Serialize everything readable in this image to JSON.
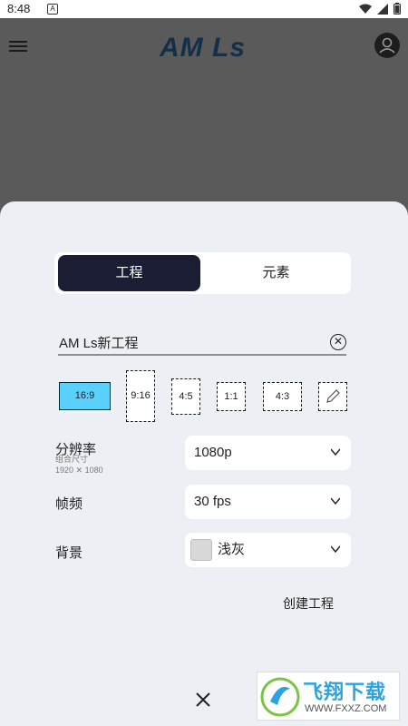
{
  "status_bar": {
    "time": "8:48",
    "notification_badge": "A"
  },
  "app": {
    "logo_text": "AM Ls"
  },
  "sheet": {
    "tabs": [
      {
        "label": "工程",
        "active": true
      },
      {
        "label": "元素",
        "active": false
      }
    ],
    "project_name": {
      "value": "AM Ls新工程"
    },
    "aspect_ratios": [
      {
        "label": "16:9",
        "selected": true
      },
      {
        "label": "9:16",
        "selected": false
      },
      {
        "label": "4:5",
        "selected": false
      },
      {
        "label": "1:1",
        "selected": false
      },
      {
        "label": "4:3",
        "selected": false
      },
      {
        "icon": "pencil-icon",
        "selected": false
      }
    ],
    "resolution": {
      "label": "分辨率",
      "sub_label": "组合尺寸",
      "size": "1920 ✕ 1080",
      "value": "1080p"
    },
    "frame_rate": {
      "label": "帧频",
      "value": "30 fps"
    },
    "background": {
      "label": "背景",
      "value": "浅灰",
      "color": "#d8d8d8"
    },
    "create_label": "创建工程"
  },
  "watermark": {
    "text": "飞翔下载",
    "url": "WWW.FXXZ.COM"
  },
  "colors": {
    "accent": "#5ad0ff",
    "tab_active": "#1a1d33",
    "sheet_bg": "#eceff3",
    "overlay": "#5a5a5a"
  }
}
